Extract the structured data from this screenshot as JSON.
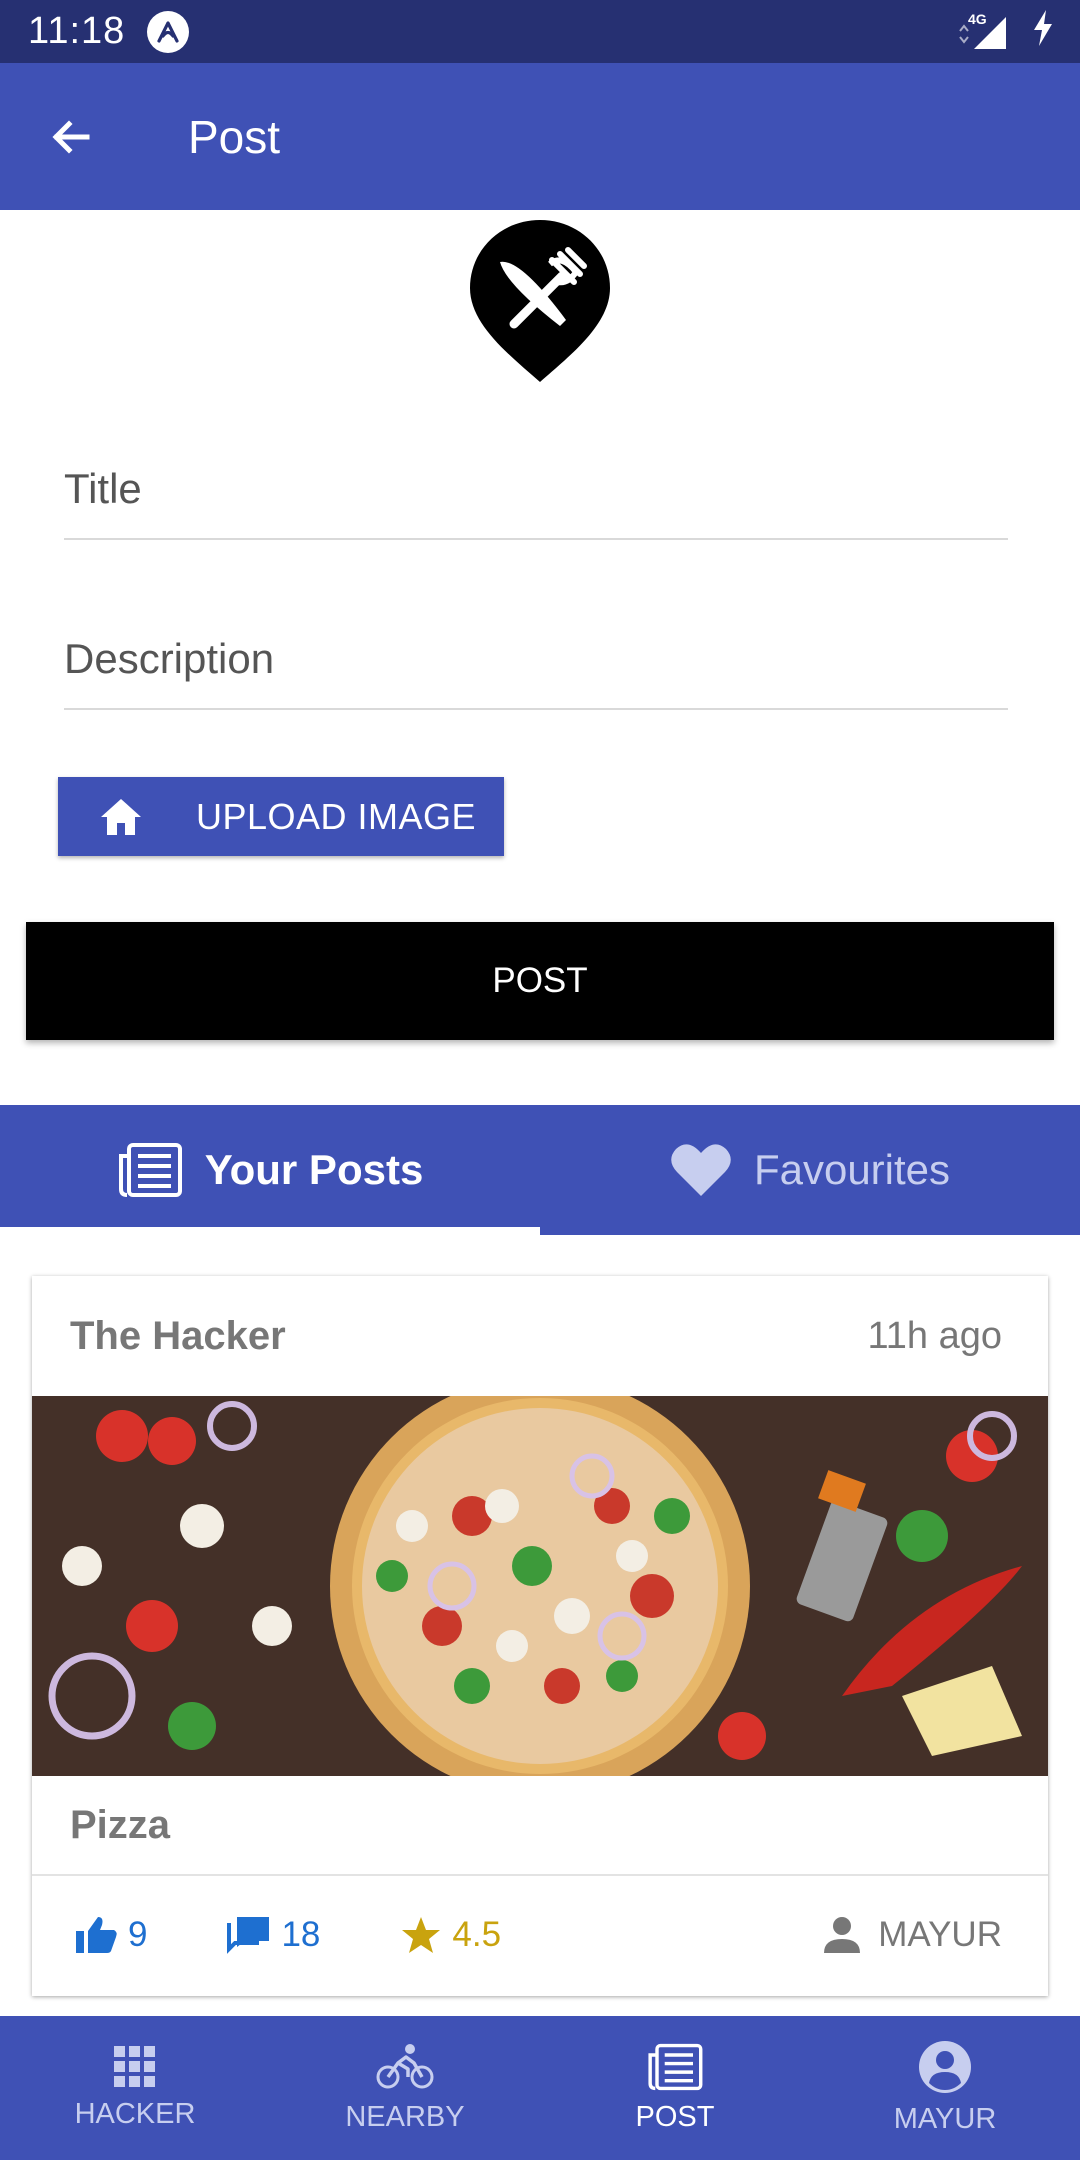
{
  "status_bar": {
    "time": "11:18",
    "network": "4G"
  },
  "app_bar": {
    "title": "Post"
  },
  "form": {
    "title_placeholder": "Title",
    "description_placeholder": "Description",
    "upload_label": "UPLOAD IMAGE",
    "post_label": "POST"
  },
  "tabs": [
    {
      "label": "Your Posts",
      "active": true
    },
    {
      "label": "Favourites",
      "active": false
    }
  ],
  "post_card": {
    "author": "The Hacker",
    "time": "11h ago",
    "title": "Pizza",
    "likes": "9",
    "comments": "18",
    "rating": "4.5",
    "user": "MAYUR"
  },
  "bottom_nav": [
    {
      "label": "HACKER",
      "icon": "grid-icon"
    },
    {
      "label": "NEARBY",
      "icon": "bike-icon"
    },
    {
      "label": "POST",
      "icon": "newspaper-icon",
      "active": true
    },
    {
      "label": "MAYUR",
      "icon": "account-icon"
    }
  ],
  "colors": {
    "primary": "#3f51b5",
    "status_bar": "#263072",
    "accent_blue": "#1e6fd0",
    "rating_gold": "#c9a30e"
  }
}
